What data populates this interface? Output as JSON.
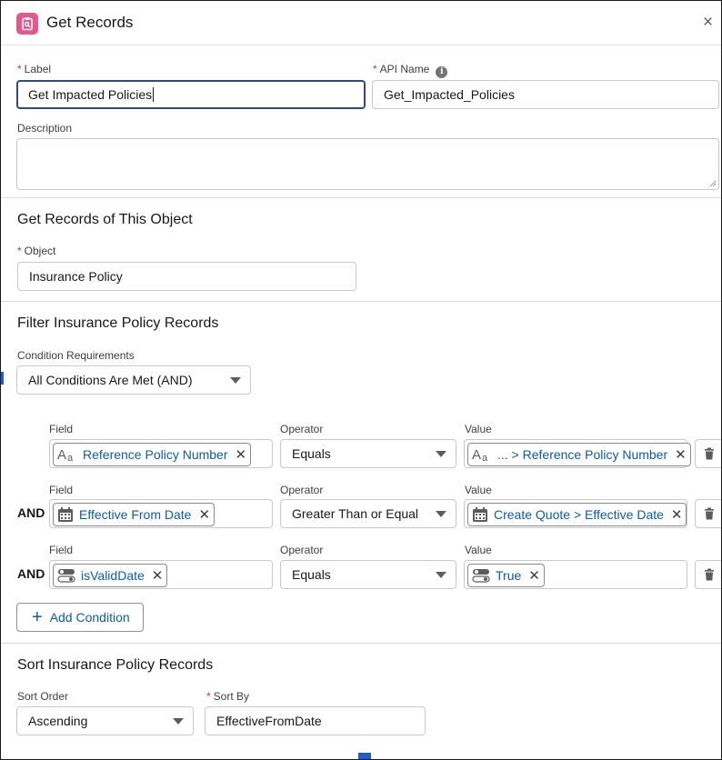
{
  "header": {
    "title": "Get Records",
    "close_glyph": "×",
    "icon": "get-records-icon"
  },
  "label_field": {
    "label": "Label",
    "value": "Get Impacted Policies"
  },
  "api_name_field": {
    "label": "API Name",
    "value": "Get_Impacted_Policies"
  },
  "description_field": {
    "label": "Description",
    "value": ""
  },
  "object_section": {
    "title": "Get Records of This Object",
    "object_label": "Object",
    "object_value": "Insurance Policy"
  },
  "filter_section": {
    "title": "Filter Insurance Policy Records",
    "condition_req_label": "Condition Requirements",
    "condition_req_value": "All Conditions Are Met (AND)",
    "conditions": [
      {
        "connector": "",
        "field_label": "Field",
        "field": "Reference Policy Number",
        "field_icon": "text-icon",
        "operator_label": "Operator",
        "operator": "Equals",
        "value_label": "Value",
        "value": "... > Reference Policy Number",
        "value_icon": "text-icon"
      },
      {
        "connector": "AND",
        "field_label": "Field",
        "field": "Effective From Date",
        "field_icon": "calendar-icon",
        "operator_label": "Operator",
        "operator": "Greater Than or Equal",
        "value_label": "Value",
        "value": "Create Quote > Effective Date",
        "value_icon": "calendar-icon"
      },
      {
        "connector": "AND",
        "field_label": "Field",
        "field": "isValidDate",
        "field_icon": "toggle-icon",
        "operator_label": "Operator",
        "operator": "Equals",
        "value_label": "Value",
        "value": "True",
        "value_icon": "toggle-icon"
      }
    ],
    "add_condition_label": "Add Condition"
  },
  "sort_section": {
    "title": "Sort Insurance Policy Records",
    "sort_order_label": "Sort Order",
    "sort_order_value": "Ascending",
    "sort_by_label": "Sort By",
    "sort_by_value": "EffectiveFromDate"
  },
  "colors": {
    "accent": "#0b5cab",
    "required": "#c23934",
    "header_icon_bg": "#e3588f",
    "focus_border": "#2e4b7a"
  }
}
